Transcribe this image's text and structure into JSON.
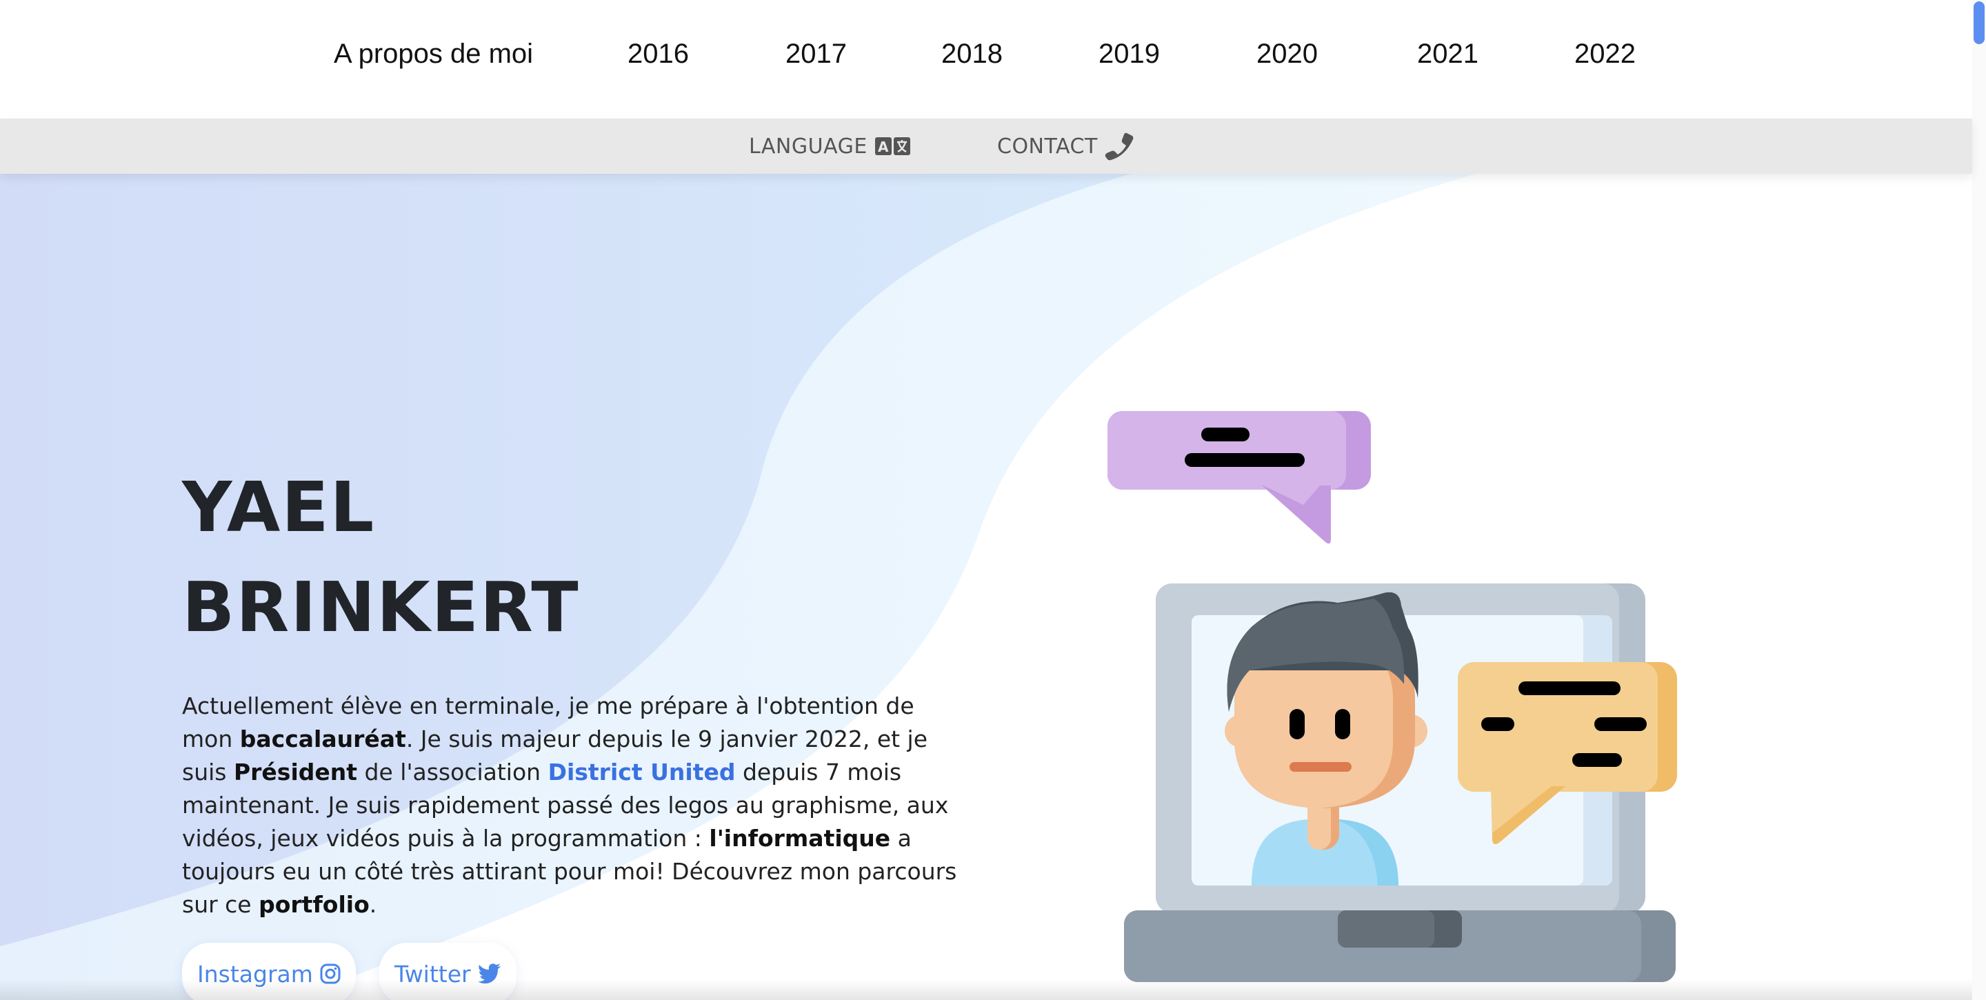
{
  "top_nav": {
    "items": [
      "A propos de moi",
      "2016",
      "2017",
      "2018",
      "2019",
      "2020",
      "2021",
      "2022"
    ]
  },
  "sub_nav": {
    "language_label": "LANGUAGE",
    "language_icon": "translate-icon",
    "contact_label": "CONTACT",
    "contact_icon": "phone-icon"
  },
  "hero": {
    "first_name": "YAEL",
    "last_name": "BRINKERT",
    "bio": {
      "p1": "Actuellement élève en terminale, je me prépare à l'obtention de mon ",
      "b1": "baccalauréat",
      "p2": ". Je suis majeur depuis le 9 janvier 2022, et je suis ",
      "b2": "Président",
      "p3": " de l'association ",
      "link": "District United",
      "p4": " depuis 7 mois maintenant. Je suis rapidement passé des legos au graphisme, aux vidéos, jeux vidéos puis à la programmation : ",
      "b3": "l'informatique",
      "p5": " a toujours eu un côté très attirant pour moi! Découvrez mon parcours sur ce ",
      "b4": "portfolio",
      "p6": "."
    },
    "social": {
      "instagram_label": "Instagram",
      "instagram_icon": "instagram-icon",
      "twitter_label": "Twitter",
      "twitter_icon": "twitter-icon"
    },
    "illustration": "person-on-laptop-video-call-illustration"
  },
  "colors": {
    "accent_link": "#3a71e0",
    "social_text": "#4a86e8",
    "subnav_bg": "#e8e8e8",
    "hero_gradient_left": "#d2ddf7",
    "hero_gradient_mid": "#dcebfb",
    "bubble_purple": "#d4b3eb",
    "bubble_orange": "#f5cf8f",
    "laptop_gray": "#c5cfd9",
    "shirt_blue": "#a7dcf7"
  }
}
